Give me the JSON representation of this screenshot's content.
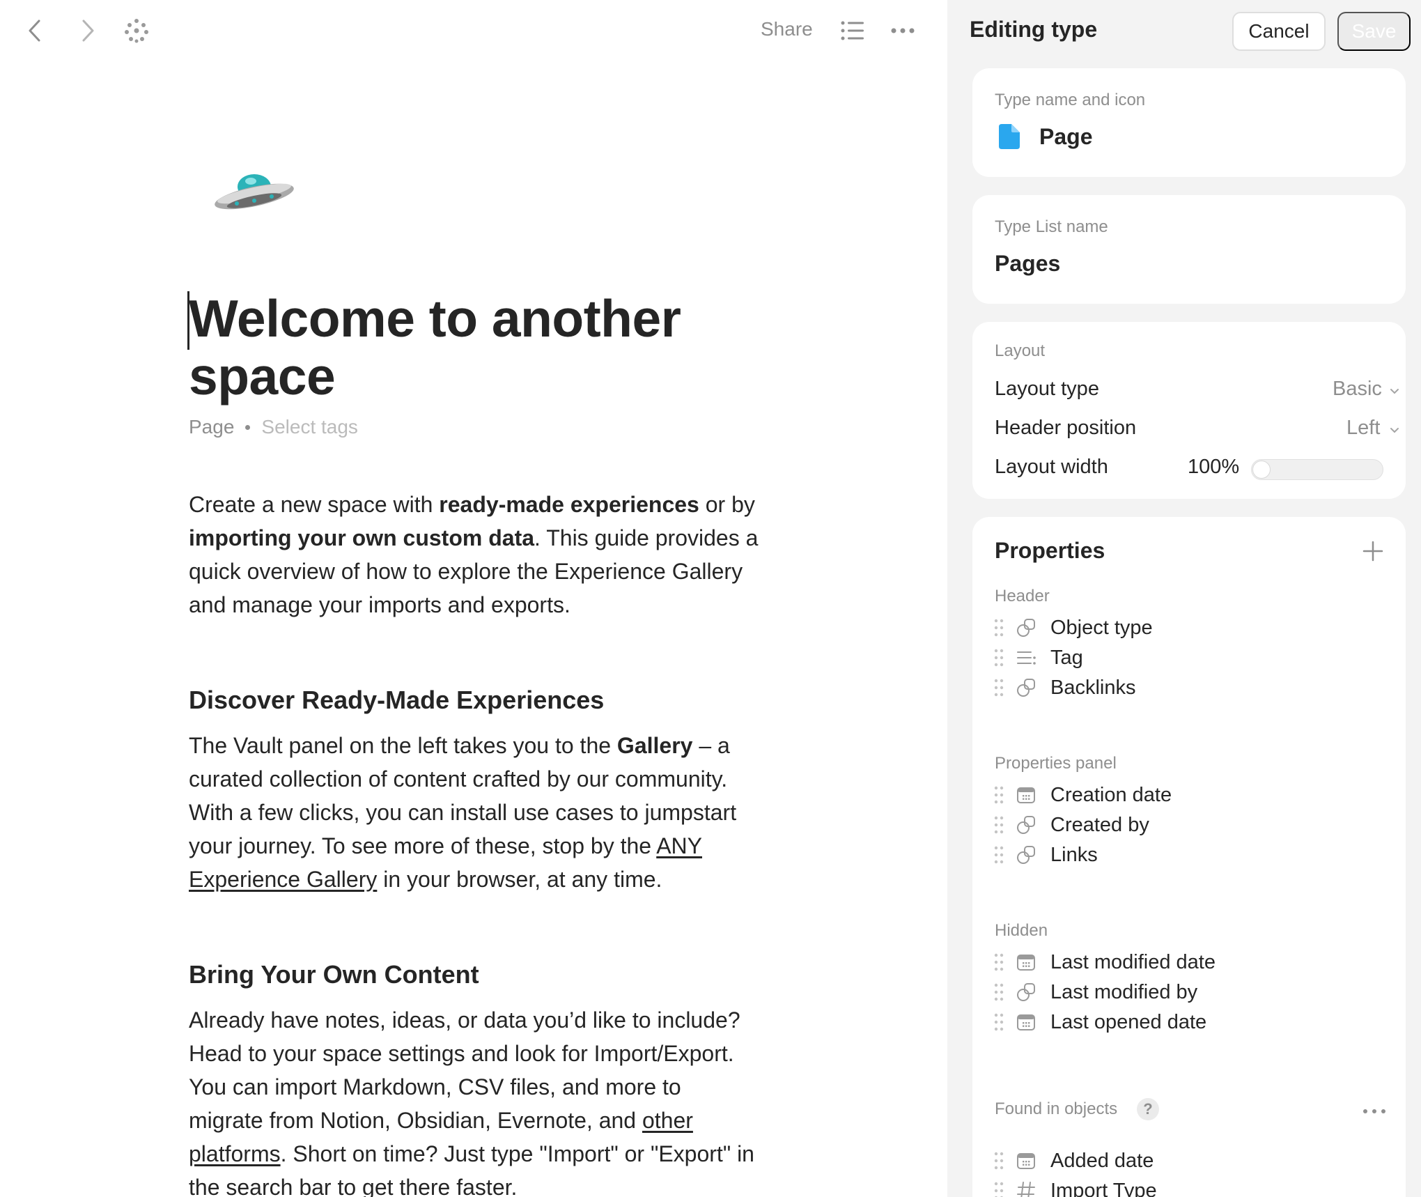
{
  "toolbar": {
    "back_icon": "chevron-left-icon",
    "forward_icon": "chevron-right-icon",
    "graph_icon": "graph-dots-icon",
    "share_label": "Share",
    "outline_icon": "list-icon",
    "more_icon": "more-horizontal-icon"
  },
  "document": {
    "emoji": "flying-saucer",
    "title": "Welcome to another space",
    "type_label": "Page",
    "tags_placeholder": "Select tags",
    "intro": {
      "p1": "Create a new space with ",
      "b1": "ready-made experiences",
      "p2": " or by ",
      "b2": "importing your own custom data",
      "p3": ". This guide provides a quick overview of how to explore the Experience Gallery and manage your imports and exports."
    },
    "section1": {
      "heading": "Discover Ready-Made Experiences",
      "p1": "The Vault panel on the left takes you to the ",
      "b1": "Gallery",
      "p2": " – a curated collection of content crafted by our community. With a few clicks, you can install use cases to jumpstart your journey. To see more of these, stop by the ",
      "link": "ANY Experience Gallery",
      "p3": " in your browser, at any time."
    },
    "section2": {
      "heading": "Bring Your Own Content",
      "p1": "Already have notes, ideas, or data you’d like to include? Head to your space settings and look for Import/Export. You can import Markdown, CSV files, and more to migrate from Notion, Obsidian, Evernote, and ",
      "link": "other platforms",
      "p2": ". Short on time? Just type \"Import\" or \"Export\" in the search bar to get there faster."
    }
  },
  "panel": {
    "title": "Editing type",
    "cancel_label": "Cancel",
    "save_label": "Save",
    "type_name": {
      "label": "Type name and icon",
      "icon": "page-file-icon",
      "icon_color": "#2aa7ee",
      "value": "Page"
    },
    "type_list": {
      "label": "Type List name",
      "value": "Pages"
    },
    "layout": {
      "label": "Layout",
      "layout_type_label": "Layout type",
      "layout_type_value": "Basic",
      "header_position_label": "Header position",
      "header_position_value": "Left",
      "layout_width_label": "Layout width",
      "layout_width_value": "100%",
      "layout_width_fraction": 0.0
    },
    "properties": {
      "title": "Properties",
      "header_group": "Header",
      "header_items": [
        {
          "label": "Object type",
          "icon": "relation-icon"
        },
        {
          "label": "Tag",
          "icon": "tag-list-icon"
        },
        {
          "label": "Backlinks",
          "icon": "relation-icon"
        }
      ],
      "panel_group": "Properties panel",
      "panel_items": [
        {
          "label": "Creation date",
          "icon": "calendar-icon"
        },
        {
          "label": "Created by",
          "icon": "relation-icon"
        },
        {
          "label": "Links",
          "icon": "relation-icon"
        }
      ],
      "hidden_group": "Hidden",
      "hidden_items": [
        {
          "label": "Last modified date",
          "icon": "calendar-icon"
        },
        {
          "label": "Last modified by",
          "icon": "relation-icon"
        },
        {
          "label": "Last opened date",
          "icon": "calendar-icon"
        }
      ],
      "found_group": "Found in objects",
      "found_help": "?",
      "found_items": [
        {
          "label": "Added date",
          "icon": "calendar-icon"
        },
        {
          "label": "Import Type",
          "icon": "hash-icon"
        }
      ]
    }
  }
}
